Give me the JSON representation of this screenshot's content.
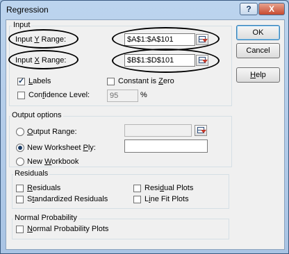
{
  "window": {
    "title": "Regression",
    "help_glyph": "?",
    "close_glyph": "X"
  },
  "input": {
    "group_label": "Input",
    "y_label_pre": "Input ",
    "y_label_acc": "Y",
    "y_label_post": " Range:",
    "y_value": "$A$1:$A$101",
    "x_label_pre": "Input ",
    "x_label_acc": "X",
    "x_label_post": " Range:",
    "x_value": "$B$1:$D$101",
    "labels_acc": "L",
    "labels_rest": "abels",
    "labels_checked": true,
    "constant_pre": "Constant is ",
    "constant_acc": "Z",
    "constant_post": "ero",
    "constant_checked": false,
    "confidence_pre": "Con",
    "confidence_acc": "f",
    "confidence_post": "idence Level:",
    "confidence_checked": false,
    "confidence_value": "95",
    "percent": "%"
  },
  "buttons": {
    "ok": "OK",
    "cancel": "Cancel",
    "help_acc": "H",
    "help_rest": "elp"
  },
  "output": {
    "group_label": "Output options",
    "output_range_pre": "",
    "output_range_acc": "O",
    "output_range_post": "utput Range:",
    "new_ws_pre": "New Worksheet ",
    "new_ws_acc": "P",
    "new_ws_post": "ly:",
    "new_wb_pre": "New ",
    "new_wb_acc": "W",
    "new_wb_post": "orkbook",
    "selected": "new_worksheet"
  },
  "residuals": {
    "group_label": "Residuals",
    "residuals_acc": "R",
    "residuals_rest": "esiduals",
    "std_pre": "S",
    "std_acc": "t",
    "std_post": "andardized Residuals",
    "resid_plots_pre": "Resi",
    "resid_plots_acc": "d",
    "resid_plots_post": "ual Plots",
    "line_fit_pre": "L",
    "line_fit_acc": "i",
    "line_fit_post": "ne Fit Plots"
  },
  "normal": {
    "group_label": "Normal Probability",
    "npp_pre": "",
    "npp_acc": "N",
    "npp_post": "ormal Probability Plots"
  }
}
